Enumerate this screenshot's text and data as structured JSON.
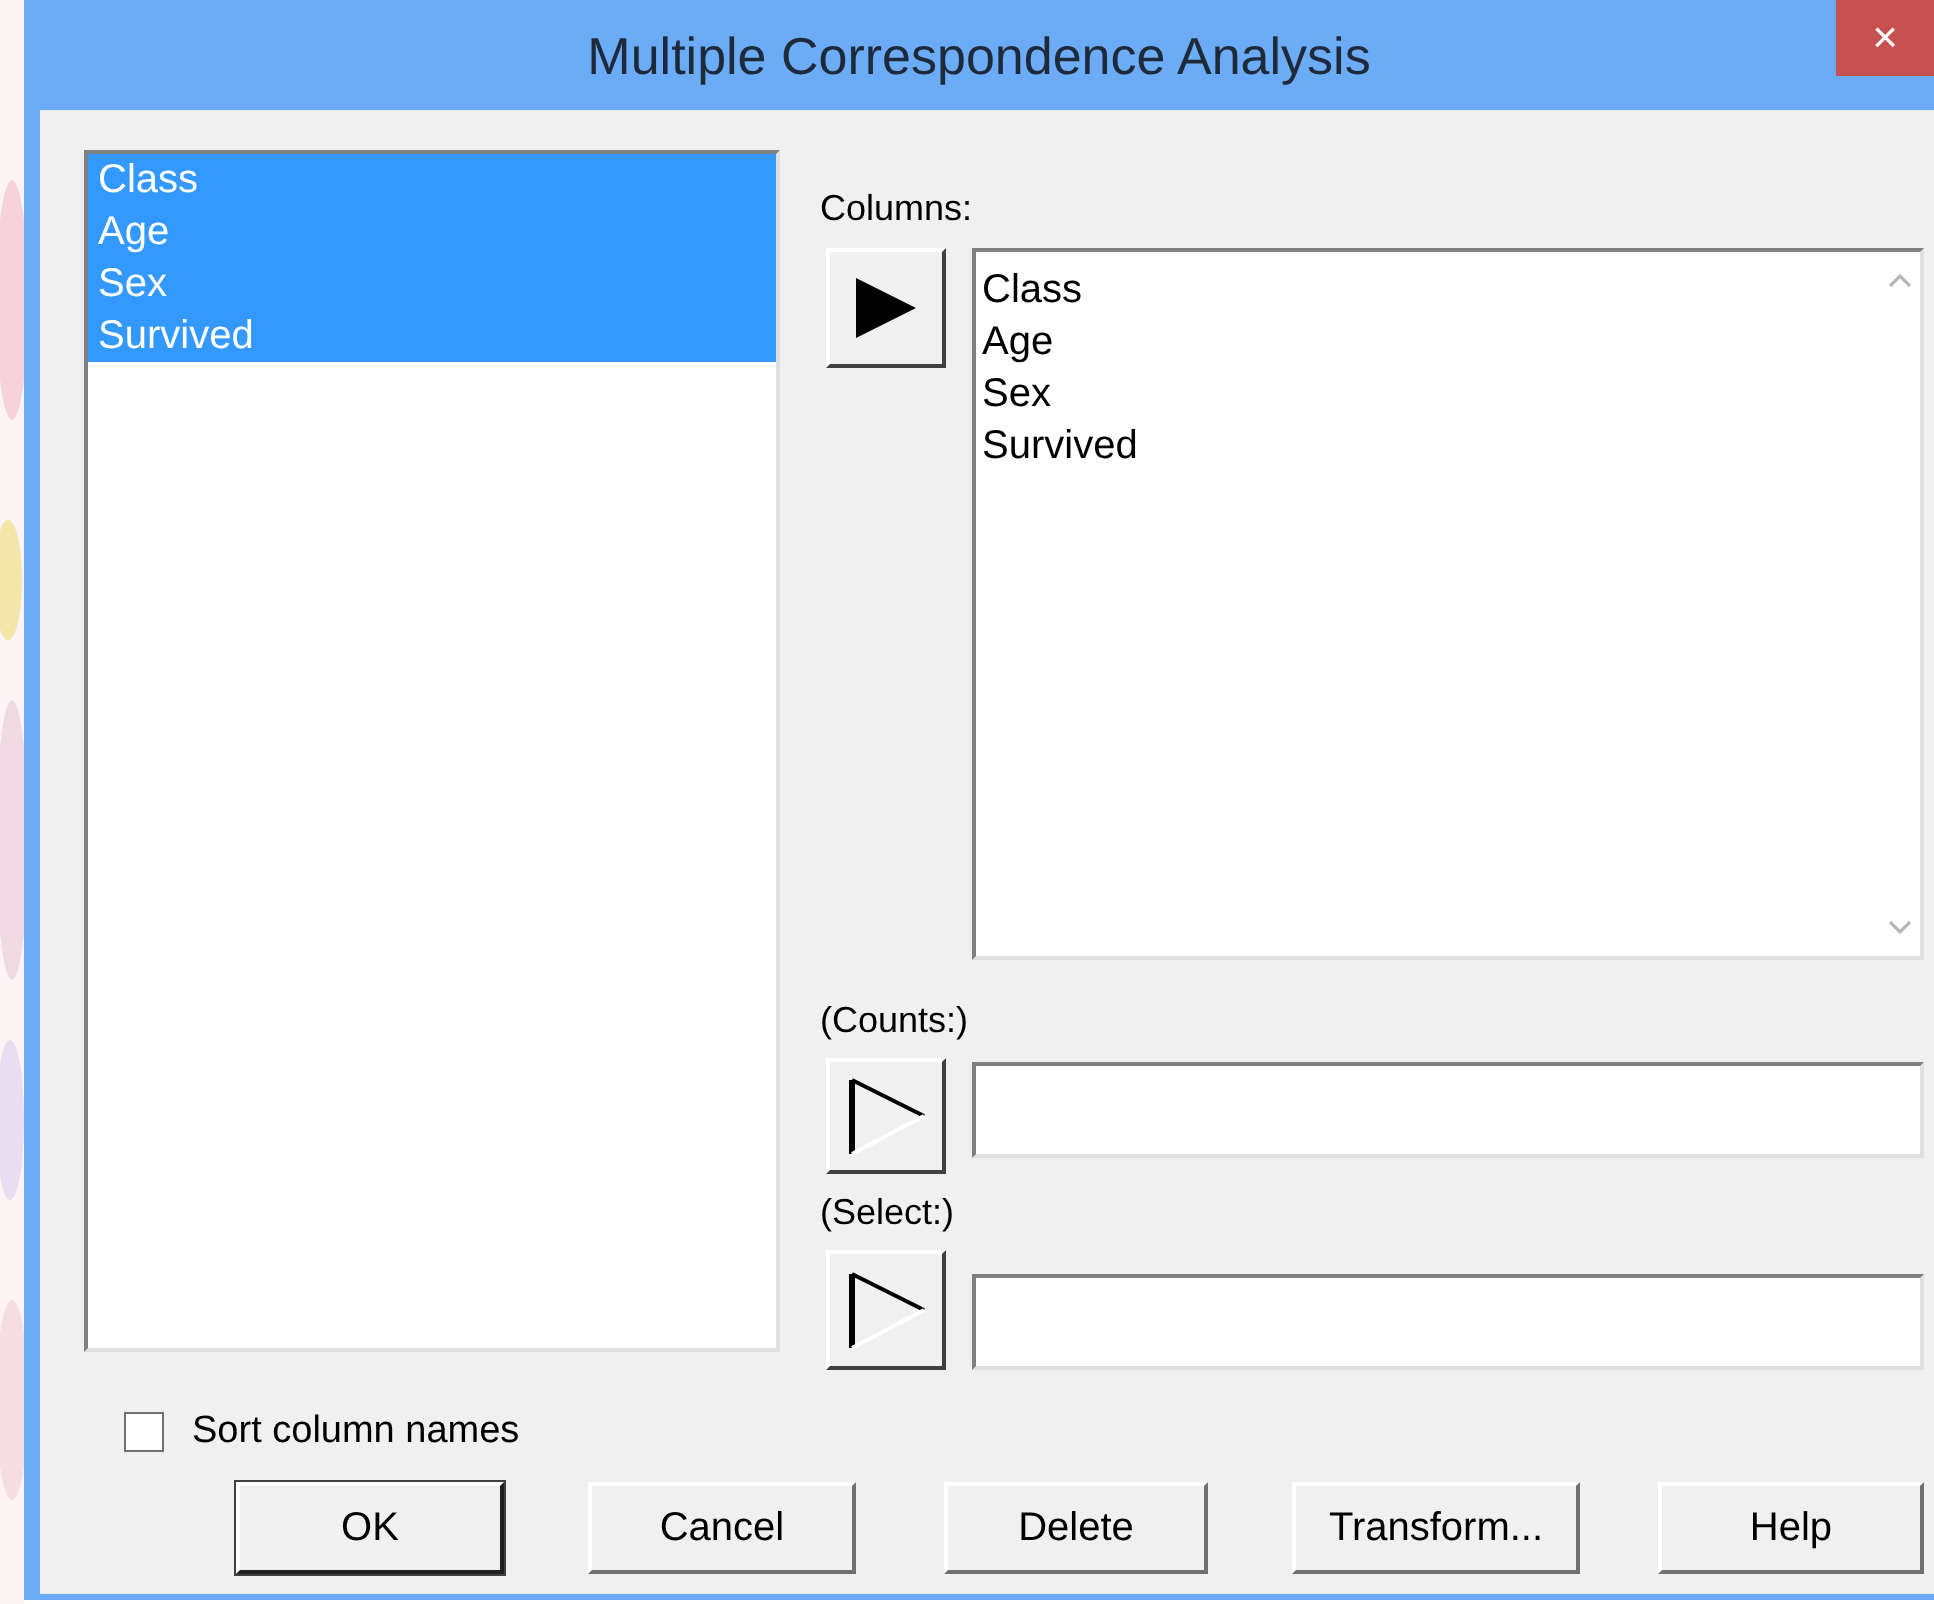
{
  "window": {
    "title": "Multiple Correspondence Analysis",
    "close": "×"
  },
  "source_list": {
    "items": [
      {
        "label": "Class",
        "selected": true
      },
      {
        "label": "Age",
        "selected": true
      },
      {
        "label": "Sex",
        "selected": true
      },
      {
        "label": "Survived",
        "selected": true
      }
    ]
  },
  "columns": {
    "label": "Columns:",
    "arrow_enabled": true,
    "items": [
      "Class",
      "Age",
      "Sex",
      "Survived"
    ]
  },
  "counts": {
    "label": "(Counts:)",
    "arrow_enabled": false
  },
  "select": {
    "label": "(Select:)",
    "arrow_enabled": false
  },
  "sort_column_names": {
    "label": "Sort column names",
    "checked": false
  },
  "buttons": [
    {
      "label": "OK",
      "default": true
    },
    {
      "label": "Cancel",
      "default": false
    },
    {
      "label": "Delete",
      "default": false
    },
    {
      "label": "Transform...",
      "default": false
    },
    {
      "label": "Help",
      "default": false
    }
  ]
}
